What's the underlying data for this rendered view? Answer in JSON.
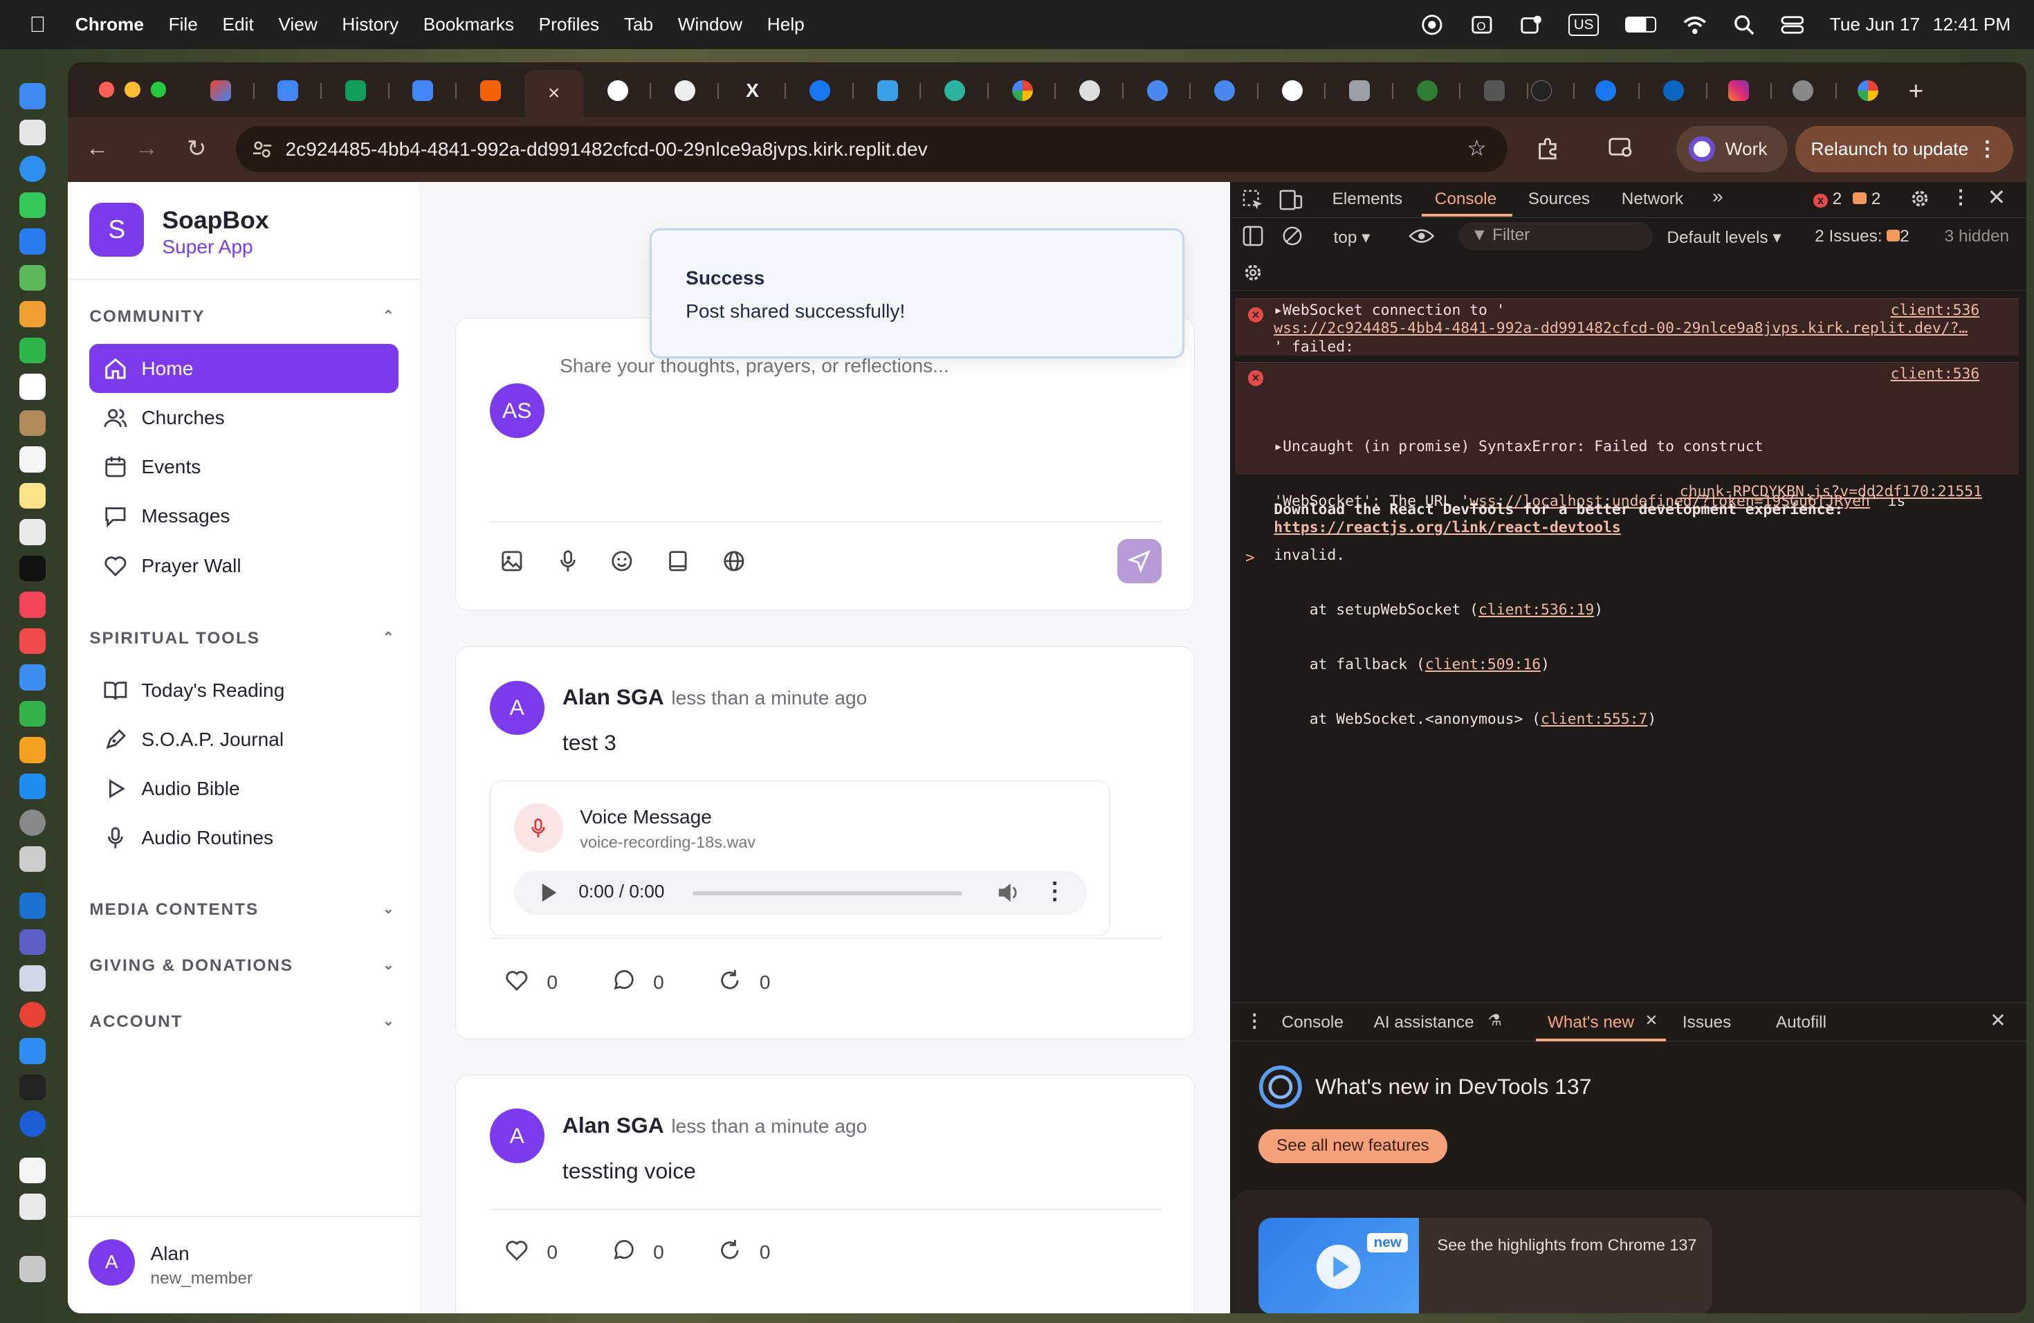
{
  "menubar": {
    "app": "Chrome",
    "items": [
      "File",
      "Edit",
      "View",
      "History",
      "Bookmarks",
      "Profiles",
      "Tab",
      "Window",
      "Help"
    ],
    "keyboard": "US",
    "date": "Tue Jun 17",
    "time": "12:41 PM"
  },
  "browser": {
    "url": "2c924485-4bb4-4841-992a-dd991482cfcd-00-29nlce9a8jvps.kirk.replit.dev",
    "profile": "Work",
    "relaunch": "Relaunch to update",
    "new_tab": "+",
    "close_tab": "×"
  },
  "sidebar": {
    "app_initial": "S",
    "app_name": "SoapBox",
    "app_subtitle": "Super App",
    "community_title": "COMMUNITY",
    "community": [
      {
        "label": "Home",
        "icon": "home-icon"
      },
      {
        "label": "Churches",
        "icon": "users-icon"
      },
      {
        "label": "Events",
        "icon": "calendar-icon"
      },
      {
        "label": "Messages",
        "icon": "message-icon"
      },
      {
        "label": "Prayer Wall",
        "icon": "heart-icon"
      }
    ],
    "spiritual_title": "SPIRITUAL TOOLS",
    "spiritual": [
      {
        "label": "Today's Reading",
        "icon": "book-open-icon"
      },
      {
        "label": "S.O.A.P. Journal",
        "icon": "pen-icon"
      },
      {
        "label": "Audio Bible",
        "icon": "play-icon"
      },
      {
        "label": "Audio Routines",
        "icon": "mic-icon"
      }
    ],
    "media_title": "MEDIA CONTENTS",
    "giving_title": "GIVING & DONATIONS",
    "account_title": "ACCOUNT",
    "user_initial": "A",
    "user_name": "Alan",
    "user_role": "new_member"
  },
  "composer": {
    "avatar": "AS",
    "placeholder": "Share your thoughts, prayers, or reflections..."
  },
  "toast": {
    "title": "Success",
    "message": "Post shared successfully!"
  },
  "posts": [
    {
      "initial": "A",
      "author": "Alan SGA",
      "time": "less than a minute ago",
      "text": "test 3",
      "voice_title": "Voice Message",
      "voice_file": "voice-recording-18s.wav",
      "audio_time": "0:00 / 0:00",
      "likes": "0",
      "comments": "0",
      "shares": "0"
    },
    {
      "initial": "A",
      "author": "Alan SGA",
      "time": "less than a minute ago",
      "text": "tessting voice",
      "likes": "0",
      "comments": "0",
      "shares": "0"
    }
  ],
  "devtools": {
    "tabs": [
      "Elements",
      "Console",
      "Sources",
      "Network"
    ],
    "errors_count": "2",
    "warnings_count": "2",
    "context": "top",
    "filter_placeholder": "Filter",
    "levels": "Default levels",
    "issues_label": "2 Issues:",
    "issues_count": "2",
    "hidden": "3 hidden",
    "log": {
      "e1_l1": "WebSocket connection to '",
      "e1_l2": "wss://2c924485-4bb4-4841-992a-dd991482cfcd-00-29nlce9a8jvps.kirk.replit.dev/?…",
      "e1_l3": "' failed:",
      "e1_src": "client:536",
      "e2_l1": "Uncaught (in promise) SyntaxError: Failed to construct",
      "e2_l2a": "'WebSocket': The URL '",
      "e2_l2b": "wss://localhost:undefined/?token=19SGu6TJRyeh",
      "e2_l2c": "' is",
      "e2_l3": "invalid.",
      "e2_l4a": "    at setupWebSocket (",
      "e2_l4b": "client:536:19",
      "e2_l5a": "    at fallback (",
      "e2_l5b": "client:509:16",
      "e2_l6a": "    at WebSocket.<anonymous> (",
      "e2_l6b": "client:555:7",
      "close_paren": ")",
      "e2_src": "client:536",
      "info_src": "chunk-RPCDYKBN.js?v=dd2df170:21551",
      "info_l1": "Download the React DevTools for a better development experience:",
      "info_l2": "https://reactjs.org/link/react-devtools",
      "prompt": ">"
    },
    "drawer_tabs": [
      "Console",
      "AI assistance",
      "What's new",
      "Issues",
      "Autofill"
    ],
    "whats_new_title": "What's new in DevTools 137",
    "see_all": "See all new features",
    "highlight_badge": "new",
    "highlight_text": "See the highlights from Chrome 137"
  },
  "colors": {
    "accent": "#7c3aed",
    "menubar": "#1f211c",
    "chrome_frame": "#3d2b23",
    "devtools_bg": "#1e1a18",
    "error_bg": "#3a2422"
  }
}
